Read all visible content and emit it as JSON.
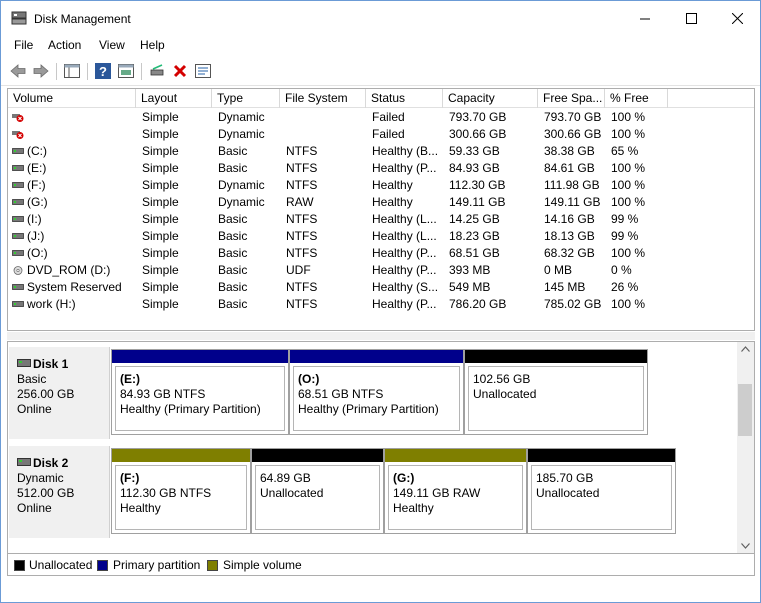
{
  "window": {
    "title": "Disk Management"
  },
  "menu": [
    "File",
    "Action",
    "View",
    "Help"
  ],
  "colors": {
    "unallocated": "#000000",
    "primary": "#00008b",
    "simple": "#7f7f00",
    "accent_blue": "#2b579a",
    "failed_red": "#d40000"
  },
  "volume_list": {
    "columns": [
      "Volume",
      "Layout",
      "Type",
      "File System",
      "Status",
      "Capacity",
      "Free Spa...",
      "% Free"
    ],
    "rows": [
      {
        "icon": "failed-disk-icon",
        "volume": "",
        "layout": "Simple",
        "type": "Dynamic",
        "fs": "",
        "status": "Failed",
        "capacity": "793.70 GB",
        "free": "793.70 GB",
        "pct": "100 %"
      },
      {
        "icon": "failed-disk-icon",
        "volume": "",
        "layout": "Simple",
        "type": "Dynamic",
        "fs": "",
        "status": "Failed",
        "capacity": "300.66 GB",
        "free": "300.66 GB",
        "pct": "100 %"
      },
      {
        "icon": "disk-icon",
        "volume": "(C:)",
        "layout": "Simple",
        "type": "Basic",
        "fs": "NTFS",
        "status": "Healthy (B...",
        "capacity": "59.33 GB",
        "free": "38.38 GB",
        "pct": "65 %"
      },
      {
        "icon": "disk-icon",
        "volume": "(E:)",
        "layout": "Simple",
        "type": "Basic",
        "fs": "NTFS",
        "status": "Healthy (P...",
        "capacity": "84.93 GB",
        "free": "84.61 GB",
        "pct": "100 %"
      },
      {
        "icon": "disk-icon",
        "volume": "(F:)",
        "layout": "Simple",
        "type": "Dynamic",
        "fs": "NTFS",
        "status": "Healthy",
        "capacity": "112.30 GB",
        "free": "111.98 GB",
        "pct": "100 %"
      },
      {
        "icon": "disk-icon",
        "volume": "(G:)",
        "layout": "Simple",
        "type": "Dynamic",
        "fs": "RAW",
        "status": "Healthy",
        "capacity": "149.11 GB",
        "free": "149.11 GB",
        "pct": "100 %"
      },
      {
        "icon": "disk-icon",
        "volume": "(I:)",
        "layout": "Simple",
        "type": "Basic",
        "fs": "NTFS",
        "status": "Healthy (L...",
        "capacity": "14.25 GB",
        "free": "14.16 GB",
        "pct": "99 %"
      },
      {
        "icon": "disk-icon",
        "volume": "(J:)",
        "layout": "Simple",
        "type": "Basic",
        "fs": "NTFS",
        "status": "Healthy (L...",
        "capacity": "18.23 GB",
        "free": "18.13 GB",
        "pct": "99 %"
      },
      {
        "icon": "disk-icon",
        "volume": "(O:)",
        "layout": "Simple",
        "type": "Basic",
        "fs": "NTFS",
        "status": "Healthy (P...",
        "capacity": "68.51 GB",
        "free": "68.32 GB",
        "pct": "100 %"
      },
      {
        "icon": "dvd-icon",
        "volume": "DVD_ROM (D:)",
        "layout": "Simple",
        "type": "Basic",
        "fs": "UDF",
        "status": "Healthy (P...",
        "capacity": "393 MB",
        "free": "0 MB",
        "pct": "0 %"
      },
      {
        "icon": "disk-icon",
        "volume": "System Reserved",
        "layout": "Simple",
        "type": "Basic",
        "fs": "NTFS",
        "status": "Healthy (S...",
        "capacity": "549 MB",
        "free": "145 MB",
        "pct": "26 %"
      },
      {
        "icon": "disk-icon",
        "volume": "work (H:)",
        "layout": "Simple",
        "type": "Basic",
        "fs": "NTFS",
        "status": "Healthy (P...",
        "capacity": "786.20 GB",
        "free": "785.02 GB",
        "pct": "100 %"
      }
    ]
  },
  "disks": [
    {
      "name": "Disk 1",
      "type": "Basic",
      "size": "256.00 GB",
      "state": "Online",
      "partitions": [
        {
          "kind": "primary",
          "name": "(E:)",
          "line1": "84.93 GB NTFS",
          "line2": "Healthy (Primary Partition)"
        },
        {
          "kind": "primary",
          "name": "(O:)",
          "line1": "68.51 GB NTFS",
          "line2": "Healthy (Primary Partition)"
        },
        {
          "kind": "unallocated",
          "name": "",
          "line1": "102.56 GB",
          "line2": "Unallocated"
        }
      ]
    },
    {
      "name": "Disk 2",
      "type": "Dynamic",
      "size": "512.00 GB",
      "state": "Online",
      "partitions": [
        {
          "kind": "simple",
          "name": "(F:)",
          "line1": "112.30 GB NTFS",
          "line2": "Healthy"
        },
        {
          "kind": "unallocated",
          "name": "",
          "line1": "64.89 GB",
          "line2": "Unallocated"
        },
        {
          "kind": "simple",
          "name": "(G:)",
          "line1": "149.11 GB RAW",
          "line2": "Healthy"
        },
        {
          "kind": "unallocated",
          "name": "",
          "line1": "185.70 GB",
          "line2": "Unallocated"
        }
      ]
    }
  ],
  "legend": [
    {
      "kind": "unallocated",
      "label": "Unallocated"
    },
    {
      "kind": "primary",
      "label": "Primary partition"
    },
    {
      "kind": "simple",
      "label": "Simple volume"
    }
  ]
}
